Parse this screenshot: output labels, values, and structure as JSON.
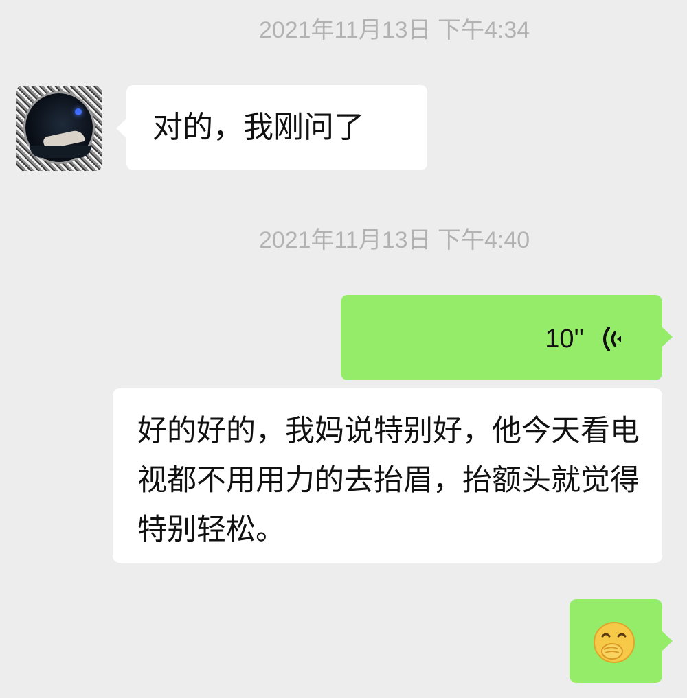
{
  "chat": {
    "timestamps": [
      "2021年11月13日 下午4:34",
      "2021年11月13日 下午4:40"
    ],
    "messages": [
      {
        "sender": "other",
        "type": "text",
        "text": "对的，我刚问了"
      },
      {
        "sender": "self",
        "type": "voice",
        "duration": "10''",
        "icon": "voice-wave-icon"
      },
      {
        "sender": "other",
        "type": "text",
        "text": "好的好的，我妈说特别好，他今天看电视都不用用力的去抬眉，抬额头就觉得特别轻松。"
      },
      {
        "sender": "self",
        "type": "emoji",
        "icon": "covering-mouth-laugh-emoji"
      }
    ]
  },
  "colors": {
    "background": "#ededed",
    "self_bubble": "#95ec69",
    "other_bubble": "#ffffff",
    "timestamp_text": "#b2b2b2"
  }
}
